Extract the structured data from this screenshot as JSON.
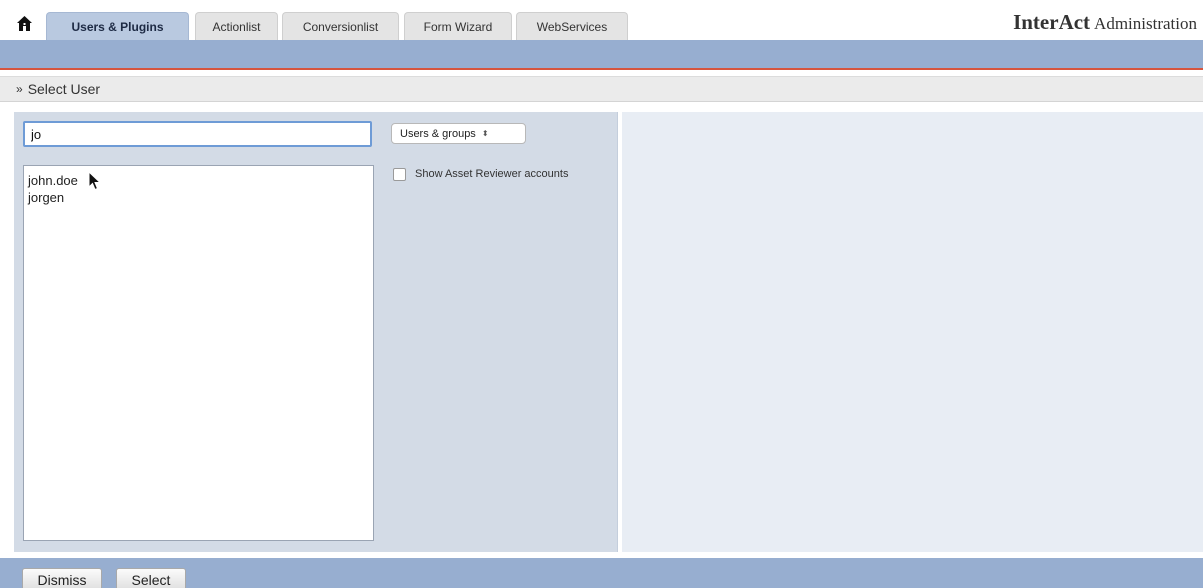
{
  "topbar": {
    "home_icon": "home-icon",
    "tabs": [
      {
        "label": "Users & Plugins",
        "active": true
      },
      {
        "label": "Actionlist",
        "active": false
      },
      {
        "label": "Conversionlist",
        "active": false
      },
      {
        "label": "Form Wizard",
        "active": false
      },
      {
        "label": "WebServices",
        "active": false
      }
    ],
    "brand_main": "InterAct",
    "brand_sub": "Administration"
  },
  "section": {
    "marker": "»",
    "title": "Select User"
  },
  "search": {
    "value": "jo"
  },
  "type_select": {
    "value": "Users & groups",
    "arrows": "⬍"
  },
  "user_list": {
    "items": [
      "john.doe",
      "jorgen"
    ]
  },
  "reviewer_toggle": {
    "label": "Show Asset Reviewer accounts",
    "checked": false
  },
  "footer": {
    "dismiss_label": "Dismiss",
    "select_label": "Select"
  },
  "colors": {
    "accent_blue": "#97aed0",
    "accent_red": "#d6553e",
    "panel_left": "#d3dbe6",
    "panel_right": "#e8edf4",
    "input_focus": "#6e9bd6"
  }
}
